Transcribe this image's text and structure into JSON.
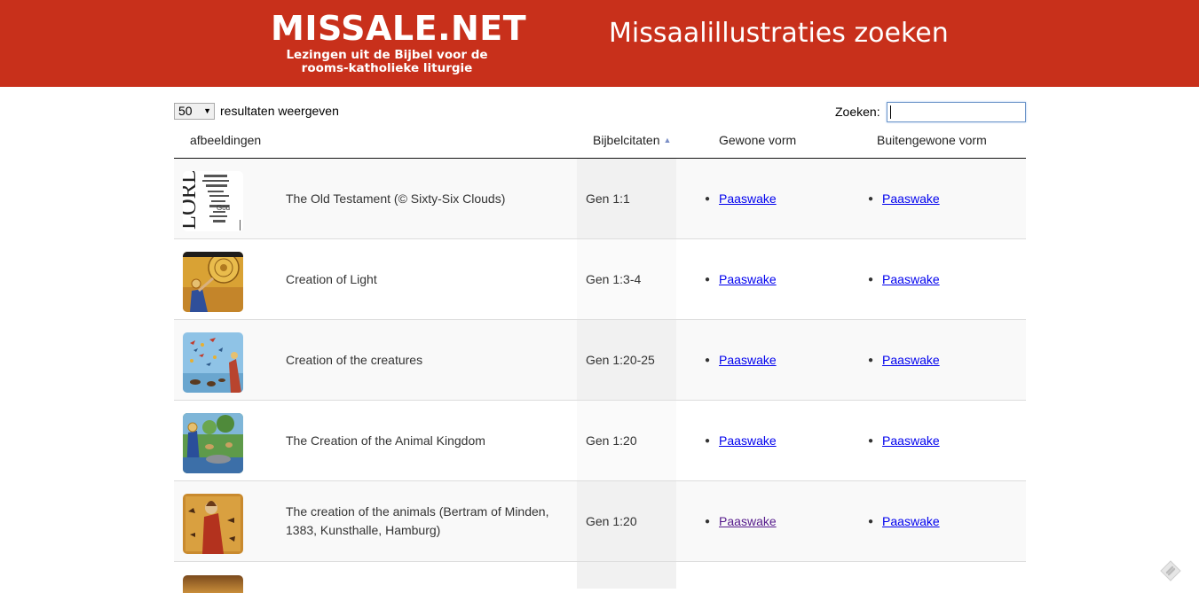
{
  "header": {
    "logo_title": "MISSALE.NET",
    "logo_subtitle": "Lezingen uit de Bijbel voor de rooms-katholieke liturgie",
    "page_heading": "Missaalillustraties zoeken",
    "brand_color": "#c8301b"
  },
  "controls": {
    "length_value": "50",
    "length_label": "resultaten weergeven",
    "search_label": "Zoeken:",
    "search_value": ""
  },
  "table": {
    "columns": [
      "afbeeldingen",
      "Bijbelcitaten",
      "Gewone vorm",
      "Buitengewone vorm"
    ],
    "sorted_column": "Bijbelcitaten",
    "sort_direction": "ascending",
    "rows": [
      {
        "title": "The Old Testament (© Sixty-Six Clouds)",
        "ref": "Gen 1:1",
        "gewone": "Paaswake",
        "buitengewone": "Paaswake",
        "thumb": "word-cloud"
      },
      {
        "title": "Creation of Light",
        "ref": "Gen 1:3-4",
        "gewone": "Paaswake",
        "buitengewone": "Paaswake",
        "thumb": "icon-gold"
      },
      {
        "title": "Creation of the creatures",
        "ref": "Gen 1:20-25",
        "gewone": "Paaswake",
        "buitengewone": "Paaswake",
        "thumb": "birds-blue"
      },
      {
        "title": "The Creation of the Animal Kingdom",
        "ref": "Gen 1:20",
        "gewone": "Paaswake",
        "buitengewone": "Paaswake",
        "thumb": "animals-green"
      },
      {
        "title": "The creation of the animals (Bertram of Minden, 1383, Kunsthalle, Hamburg)",
        "ref": "Gen 1:20",
        "gewone": "Paaswake",
        "buitengewone": "Paaswake",
        "thumb": "medieval-red",
        "gewone_visited": true
      }
    ]
  },
  "icons": {
    "sort": "sort-ascending-icon",
    "corner": "diamond-tag-icon"
  }
}
